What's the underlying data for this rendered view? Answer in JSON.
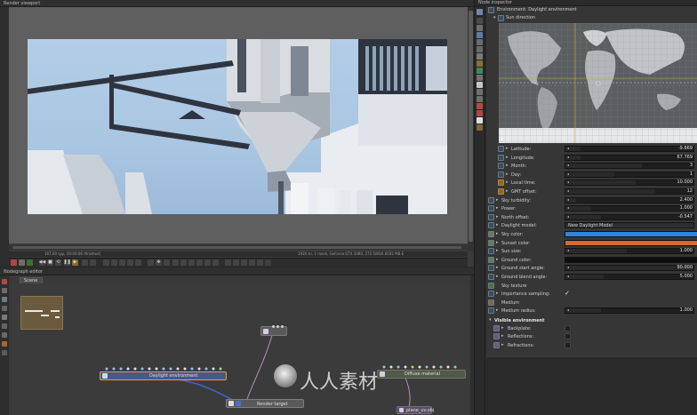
{
  "viewport": {
    "title": "Render viewport",
    "status_left": "167.00 spp, 00:00:06 (finished)",
    "status_right": "1920 tri, 1 mesh, GeForce GTX 1080, 272.5/8G6 8192 MB E"
  },
  "nodegraph": {
    "title": "Nodegraph editor",
    "tab": "Scene",
    "nodes": {
      "daylight": "Daylight environment",
      "render_target": "Render target",
      "material": "Diffuse material",
      "plane": "plane_uv.obj"
    }
  },
  "inspector": {
    "title": "Node inspector",
    "node_header": "Environment: Daylight environment",
    "sun_direction": "Sun direction",
    "sun_params": [
      {
        "label": "Latitude:",
        "value": "-9.669"
      },
      {
        "label": "Longitude:",
        "value": "67.769"
      },
      {
        "label": "Month:",
        "value": "3"
      },
      {
        "label": "Day:",
        "value": "1"
      },
      {
        "label": "Local time:",
        "value": "10.000"
      },
      {
        "label": "GMT offset:",
        "value": "12"
      }
    ],
    "params": [
      {
        "label": "Sky turbidity:",
        "value": "2.400"
      },
      {
        "label": "Power:",
        "value": "1.000"
      },
      {
        "label": "North offset:",
        "value": "-0.547"
      }
    ],
    "daylight_model_label": "Daylight model:",
    "daylight_model_value": "New Daylight Model",
    "sky_color_label": "Sky color:",
    "sky_color": "#2f86d8",
    "sunset_color_label": "Sunset color:",
    "sunset_color": "#d9692c",
    "sun_size_label": "Sun size:",
    "sun_size_value": "1.000",
    "ground_color_label": "Ground color:",
    "ground_start_label": "Ground start angle:",
    "ground_start_value": "90.000",
    "ground_blend_label": "Ground blend angle:",
    "ground_blend_value": "5.000",
    "sky_texture_label": "Sky texture",
    "importance_label": "Importance sampling:",
    "importance_check": "✓",
    "medium_label": "Medium",
    "medium_radius_label": "Medium radius:",
    "medium_radius_value": "1.000",
    "visible_env_header": "Visible environment",
    "visible_env_items": [
      "Backplate:",
      "Reflections:",
      "Refractions:"
    ]
  },
  "watermark": "人人素材"
}
